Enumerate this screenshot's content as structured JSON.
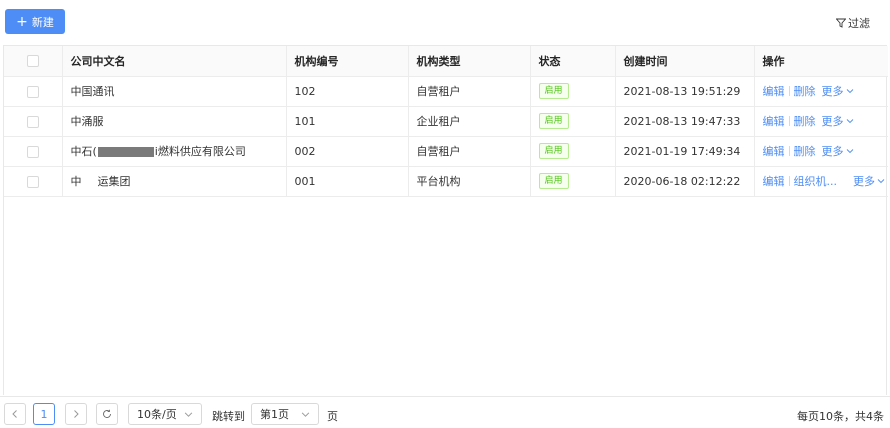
{
  "toolbar": {
    "new_label": "新建",
    "filter_label": "过滤"
  },
  "table": {
    "columns": [
      "公司中文名",
      "机构编号",
      "机构类型",
      "状态",
      "创建时间",
      "操作"
    ],
    "rows": [
      {
        "name": "中国通讯",
        "code": "102",
        "type": "自营租户",
        "status": "启用",
        "created": "2021-08-13 19:51:29",
        "op1": "编辑",
        "op2": "删除",
        "more": "更多"
      },
      {
        "name": "中涌服",
        "code": "101",
        "type": "企业租户",
        "status": "启用",
        "created": "2021-08-13 19:47:33",
        "op1": "编辑",
        "op2": "删除",
        "more": "更多"
      },
      {
        "name_prefix": "中石(",
        "name_suffix": "i燃料供应有限公司",
        "code": "002",
        "type": "自营租户",
        "status": "启用",
        "created": "2021-01-19 17:49:34",
        "op1": "编辑",
        "op2": "删除",
        "more": "更多"
      },
      {
        "name_prefix": "中",
        "name_suffix": "运集团",
        "code": "001",
        "type": "平台机构",
        "status": "启用",
        "created": "2020-06-18 02:12:22",
        "op1": "编辑",
        "op2": "组织机...",
        "more": "更多"
      }
    ]
  },
  "pagination": {
    "current_page": "1",
    "page_size": "10条/页",
    "jump_label": "跳转到",
    "jump_value": "第1页",
    "page_unit": "页",
    "summary": "每页10条，共4条"
  },
  "colors": {
    "primary": "#4e8df5",
    "tag_green": "#52c41a"
  }
}
